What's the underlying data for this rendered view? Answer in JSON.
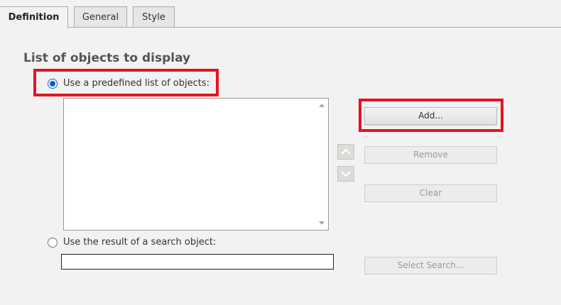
{
  "tabs": [
    {
      "label": "Definition",
      "active": true
    },
    {
      "label": "General",
      "active": false
    },
    {
      "label": "Style",
      "active": false
    }
  ],
  "section": {
    "title": "List of objects to display"
  },
  "options": {
    "predefined_label": "Use a predefined list of objects:",
    "predefined_selected": true,
    "search_label": "Use the result of a search object:",
    "search_selected": false
  },
  "list": {
    "items": []
  },
  "buttons": {
    "add": "Add...",
    "remove": "Remove",
    "clear": "Clear",
    "select_search": "Select Search..."
  },
  "search_object": {
    "value": ""
  },
  "icons": {
    "move_up": "chevron-up-icon",
    "move_down": "chevron-down-icon"
  },
  "colors": {
    "highlight": "#e81123",
    "radio_selected": "#0a62c9",
    "background": "#f2f2f2"
  }
}
